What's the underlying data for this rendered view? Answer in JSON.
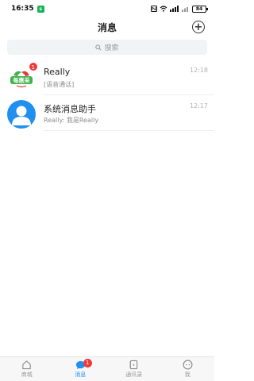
{
  "status_bar": {
    "time": "16:35",
    "app_indicator": "s",
    "signal_text": "⌘ 📶 HD",
    "battery": "84"
  },
  "header": {
    "title": "消息",
    "add_icon": "plus-circle-icon"
  },
  "search": {
    "placeholder": "搜索",
    "icon": "search-icon"
  },
  "conversations": [
    {
      "name": "Really",
      "preview": "[语音通话]",
      "time": "12:18",
      "badge": "1",
      "avatar_text": "每惠采"
    },
    {
      "name": "系统消息助手",
      "preview": "Really: 我是Really",
      "time": "12:17",
      "badge": "",
      "avatar_icon": "person-icon"
    }
  ],
  "tabbar": {
    "tabs": [
      {
        "label": "商城",
        "icon": "home-icon"
      },
      {
        "label": "消息",
        "icon": "chat-icon",
        "badge": "1",
        "active": true
      },
      {
        "label": "通讯录",
        "icon": "contacts-icon"
      },
      {
        "label": "我",
        "icon": "profile-icon"
      }
    ]
  },
  "colors": {
    "accent": "#1f8ff0",
    "badge": "#f03a3a",
    "logo_green": "#3fb24a",
    "logo_red": "#e53935"
  }
}
